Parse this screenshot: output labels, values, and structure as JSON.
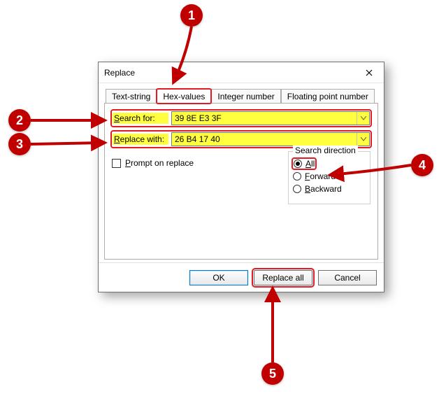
{
  "window": {
    "title": "Replace"
  },
  "tabs": {
    "items": [
      {
        "label": "Text-string"
      },
      {
        "label": "Hex-values"
      },
      {
        "label": "Integer number"
      },
      {
        "label": "Floating point number"
      }
    ],
    "active_index": 1
  },
  "form": {
    "search_label": "Search for:",
    "search_accel": "S",
    "search_value": "39 8E E3 3F",
    "replace_label": "Replace with:",
    "replace_accel": "R",
    "replace_value": "26 B4 17 40",
    "prompt_label": "Prompt on replace",
    "prompt_accel": "P",
    "prompt_checked": false
  },
  "direction": {
    "title": "Search direction",
    "options": [
      {
        "label": "All",
        "accel": "A",
        "selected": true
      },
      {
        "label": "Forward",
        "accel": "F",
        "selected": false
      },
      {
        "label": "Backward",
        "accel": "B",
        "selected": false
      }
    ]
  },
  "buttons": {
    "ok": "OK",
    "replace_all": "Replace all",
    "cancel": "Cancel"
  },
  "callouts": {
    "c1": "1",
    "c2": "2",
    "c3": "3",
    "c4": "4",
    "c5": "5"
  }
}
